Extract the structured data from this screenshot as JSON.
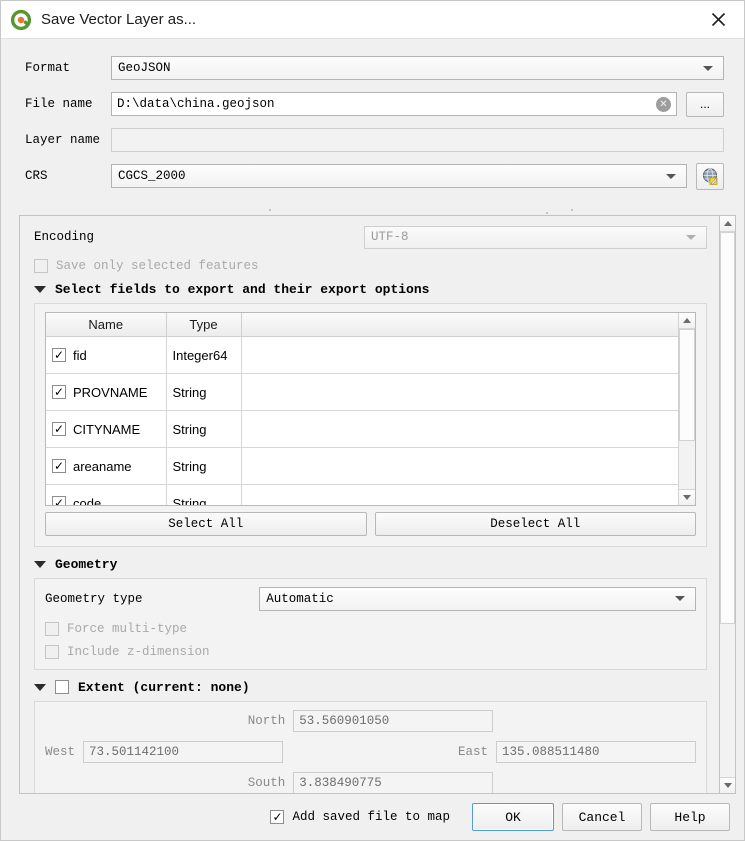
{
  "window": {
    "title": "Save Vector Layer as...",
    "icon": "qgis-logo-icon",
    "close_icon": "close-icon"
  },
  "form": {
    "format": {
      "label": "Format",
      "value": "GeoJSON"
    },
    "file_name": {
      "label": "File name",
      "value": "D:\\data\\china.geojson",
      "clear_icon": "clear-icon",
      "browse_label": "..."
    },
    "layer_name": {
      "label": "Layer name",
      "value": "",
      "placeholder": ""
    },
    "crs": {
      "label": "CRS",
      "value": "CGCS_2000",
      "select_icon": "globe-select-crs-icon"
    }
  },
  "options": {
    "encoding": {
      "label": "Encoding",
      "value": "UTF-8"
    },
    "save_only_selected": {
      "label": "Save only selected features",
      "checked": false,
      "enabled": false
    },
    "fields_section": {
      "title": "Select fields to export and their export options",
      "expanded": true,
      "columns": [
        "Name",
        "Type",
        ""
      ],
      "rows": [
        {
          "name": "fid",
          "type": "Integer64",
          "checked": true
        },
        {
          "name": "PROVNAME",
          "type": "String",
          "checked": true
        },
        {
          "name": "CITYNAME",
          "type": "String",
          "checked": true
        },
        {
          "name": "areaname",
          "type": "String",
          "checked": true
        },
        {
          "name": "code",
          "type": "String",
          "checked": true
        }
      ],
      "select_all_label": "Select All",
      "deselect_all_label": "Deselect All"
    },
    "geometry_section": {
      "title": "Geometry",
      "expanded": true,
      "geometry_type": {
        "label": "Geometry type",
        "value": "Automatic"
      },
      "force_multi": {
        "label": "Force multi-type",
        "checked": false,
        "enabled": false
      },
      "include_z": {
        "label": "Include z-dimension",
        "checked": false,
        "enabled": false
      }
    },
    "extent_section": {
      "title": "Extent (current: none)",
      "expanded": true,
      "checked": false,
      "north": {
        "label": "North",
        "value": "53.560901050"
      },
      "west": {
        "label": "West",
        "value": "73.501142100"
      },
      "east": {
        "label": "East",
        "value": "135.088511480"
      },
      "south": {
        "label": "South",
        "value": "3.838490775"
      }
    }
  },
  "footer": {
    "add_saved_file": {
      "label": "Add saved file to map",
      "checked": true
    },
    "ok_label": "OK",
    "cancel_label": "Cancel",
    "help_label": "Help"
  },
  "colors": {
    "dialog_bg": "#f0f0f0",
    "titlebar_bg": "#ffffff",
    "accent_default_button": "#4f9ed8",
    "logo_green": "#589632",
    "logo_orange": "#e8792a"
  }
}
